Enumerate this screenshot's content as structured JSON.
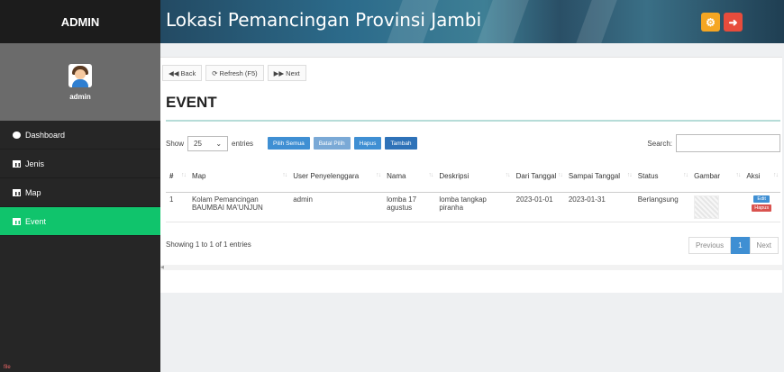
{
  "sidebar": {
    "brand": "ADMIN",
    "profile_name": "admin",
    "items": [
      {
        "label": "Dashboard",
        "icon": "dashboard-icon"
      },
      {
        "label": "Jenis",
        "icon": "table-icon"
      },
      {
        "label": "Map",
        "icon": "table-icon"
      },
      {
        "label": "Event",
        "icon": "table-icon"
      }
    ],
    "active_item": "Event",
    "tag": "file"
  },
  "header": {
    "title": "Lokasi Pemancingan Provinsi Jambi",
    "settings_icon": "gear-icon",
    "logout_icon": "arrow-right-icon"
  },
  "toolbar": {
    "back_label": "Back",
    "refresh_label": "Refresh (F5)",
    "next_label": "Next"
  },
  "page": {
    "title": "EVENT"
  },
  "controls": {
    "show_label": "Show",
    "entries_value": "25",
    "entries_label": "entries",
    "btn_pilih_semua": "Pilih Semua",
    "btn_batal_pilih": "Batal Pilih",
    "btn_hapus": "Hapus",
    "btn_tambah": "Tambah",
    "search_label": "Search:",
    "search_value": ""
  },
  "table": {
    "headers": [
      "#",
      "Map",
      "User Penyelenggara",
      "Nama",
      "Deskripsi",
      "Dari Tanggal",
      "Sampai Tanggal",
      "Status",
      "Gambar",
      "Aksi"
    ],
    "rows": [
      {
        "no": "1",
        "map": "Kolam Pemancingan BAUMBAI MA'UNJUN",
        "user": "admin",
        "nama": "lomba 17 agustus",
        "deskripsi": "lomba tangkap piranha",
        "dari": "2023-01-01",
        "sampai": "2023-01-31",
        "status": "Berlangsung",
        "edit_label": "Edit",
        "hapus_label": "Hapus"
      }
    ]
  },
  "footer": {
    "info": "Showing 1 to 1 of 1 entries",
    "previous": "Previous",
    "page": "1",
    "next": "Next"
  },
  "colors": {
    "sidebar_bg": "#262626",
    "active_green": "#10c46c",
    "primary_blue": "#3f8fd3",
    "danger_red": "#d9534f",
    "gear_orange": "#f5a623",
    "logout_red": "#e74c3c"
  }
}
